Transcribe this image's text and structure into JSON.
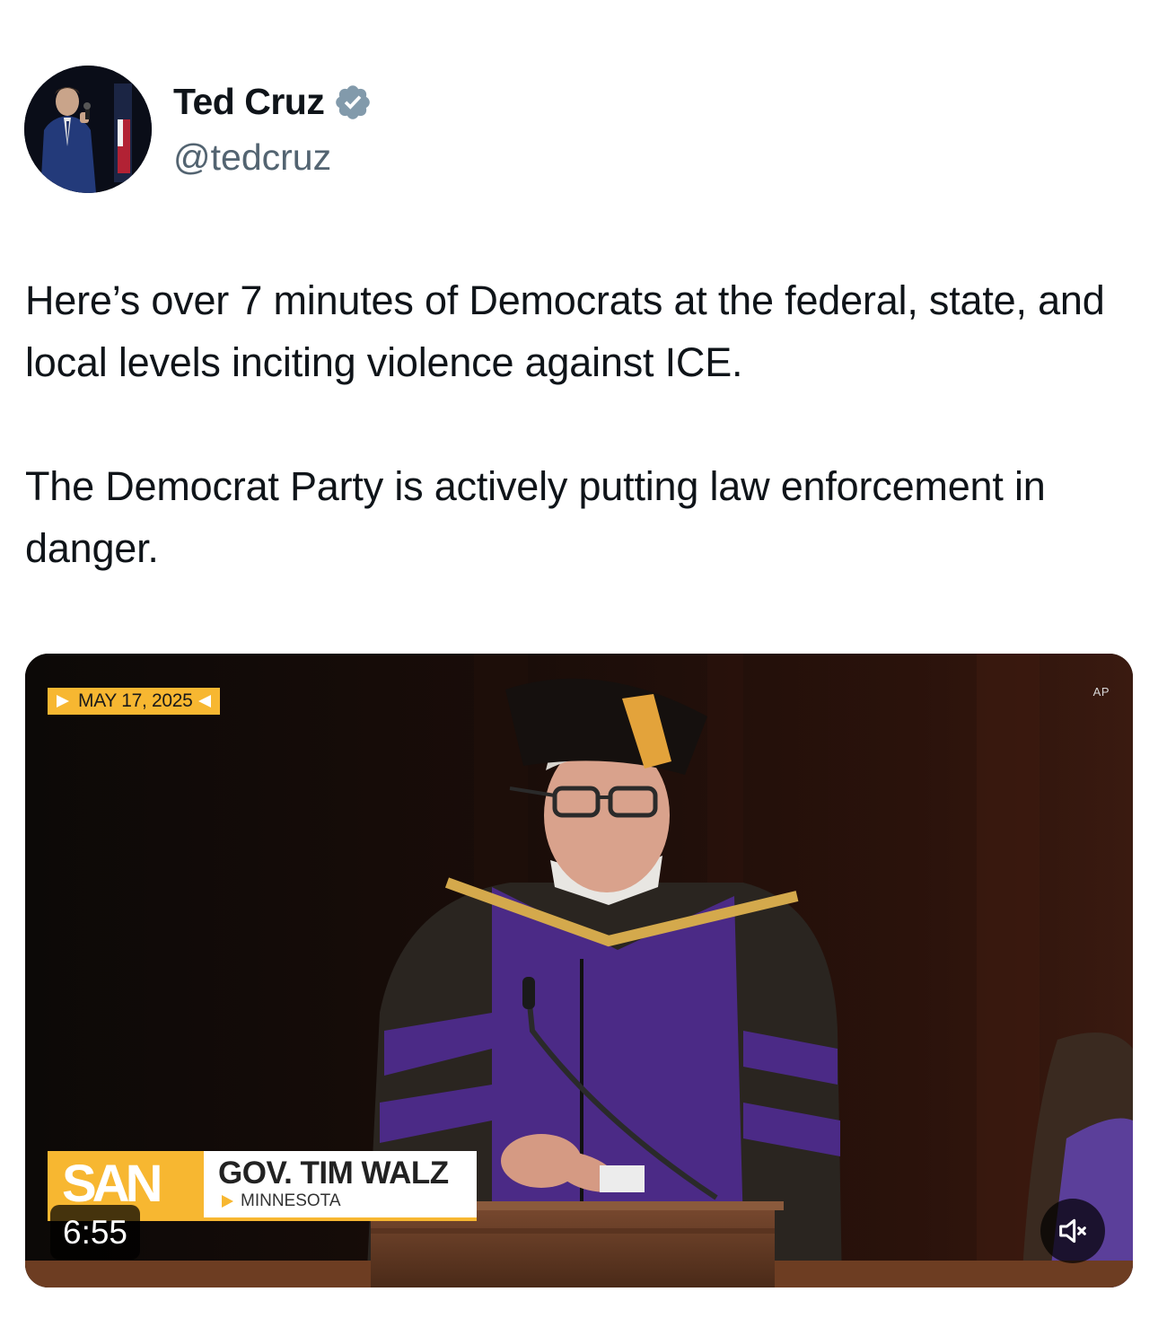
{
  "author": {
    "display_name": "Ted Cruz",
    "handle": "@tedcruz",
    "verified": true,
    "avatar_icon": "profile-photo"
  },
  "tweet": {
    "paragraphs": [
      "Here’s over 7 minutes of Democrats at the federal, state, and local levels inciting violence against ICE.",
      "The Democrat Party is actively putting law enforcement in danger."
    ]
  },
  "media": {
    "type": "video",
    "date_tag": "MAY 17, 2025",
    "source_mark": "AP",
    "network_logo": "SAN",
    "lower_third_name": "GOV. TIM WALZ",
    "lower_third_location": "MINNESOTA",
    "duration": "6:55",
    "muted": true,
    "mute_icon": "speaker-muted-icon"
  },
  "colors": {
    "accent_verified": "#829aab",
    "text_primary": "#0f1419",
    "text_secondary": "#536471",
    "lower_third_yellow": "#f7b731"
  }
}
